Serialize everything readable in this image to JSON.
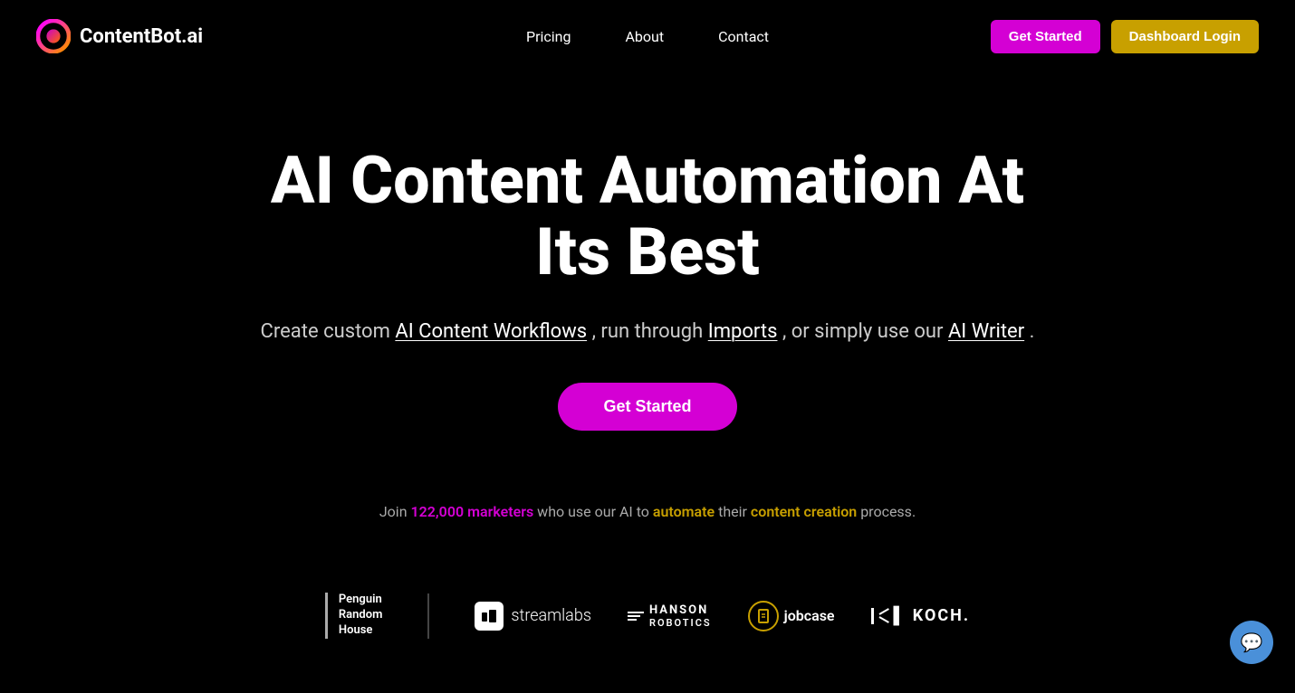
{
  "brand": {
    "name": "ContentBot.ai"
  },
  "header": {
    "nav": [
      {
        "label": "Pricing",
        "href": "#"
      },
      {
        "label": "About",
        "href": "#"
      },
      {
        "label": "Contact",
        "href": "#"
      }
    ],
    "get_started_label": "Get Started",
    "dashboard_login_label": "Dashboard Login"
  },
  "hero": {
    "title": "AI Content Automation At Its Best",
    "subtitle_prefix": "Create custom",
    "subtitle_link1": "AI Content Workflows",
    "subtitle_mid": ", run through",
    "subtitle_link2": "Imports",
    "subtitle_suffix": ", or simply use our",
    "subtitle_link3": "AI Writer",
    "subtitle_end": ".",
    "cta_label": "Get Started"
  },
  "social_proof": {
    "prefix": "Join",
    "count": "122,000",
    "count_suffix": "marketers",
    "middle": "who use our AI to",
    "automate": "automate",
    "suffix1": "their",
    "content_creation": "content creation",
    "suffix2": "process."
  },
  "brands": [
    {
      "name": "Penguin Random House",
      "type": "penguin"
    },
    {
      "name": "streamlabs",
      "type": "streamlabs"
    },
    {
      "name": "HANSON ROBOTICS",
      "type": "hanson"
    },
    {
      "name": "jobcase",
      "type": "jobcase"
    },
    {
      "name": "KOCH",
      "type": "koch"
    }
  ],
  "chat": {
    "icon": "💬"
  }
}
